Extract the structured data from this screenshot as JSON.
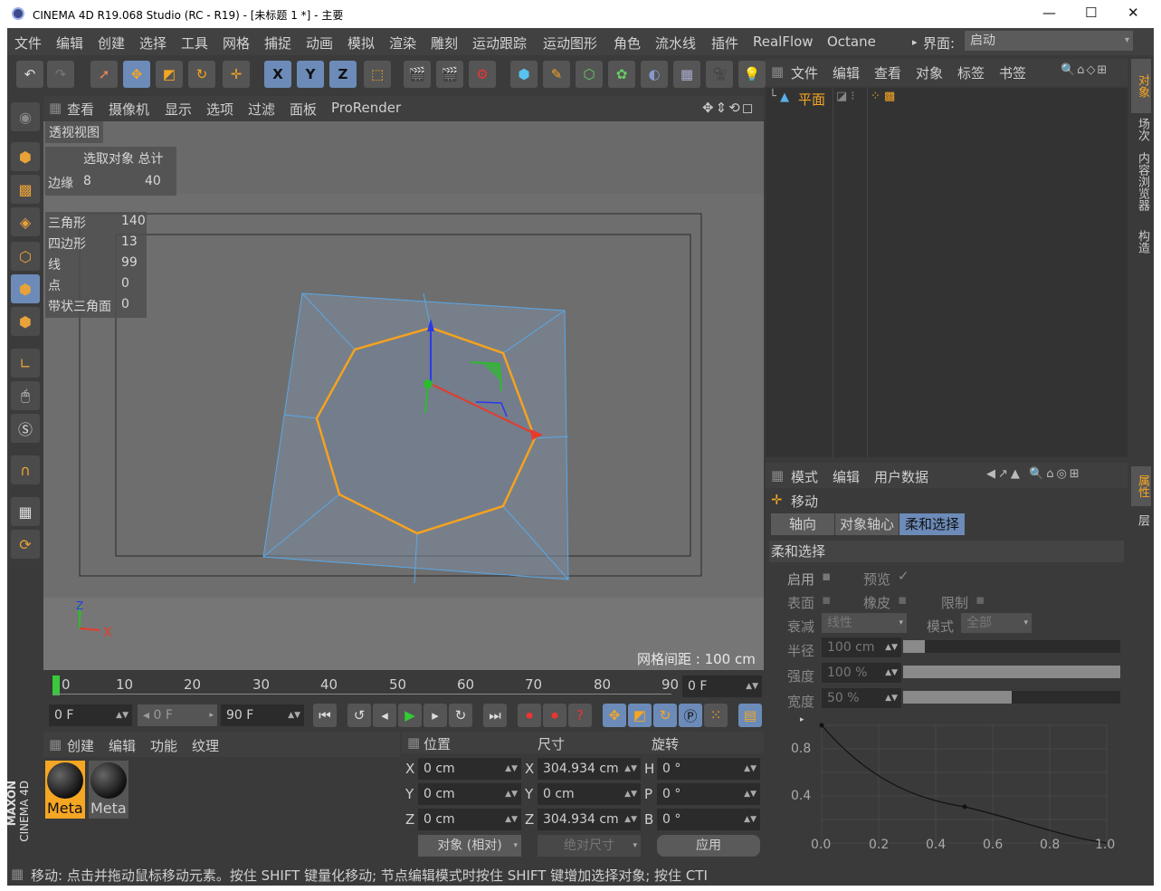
{
  "window": {
    "title": "CINEMA 4D R19.068 Studio (RC - R19) - [未标题 1 *] - 主要",
    "minimize": "—",
    "maximize": "☐",
    "close": "✕"
  },
  "menu": [
    "文件",
    "编辑",
    "创建",
    "选择",
    "工具",
    "网格",
    "捕捉",
    "动画",
    "模拟",
    "渲染",
    "雕刻",
    "运动跟踪",
    "运动图形",
    "角色",
    "流水线",
    "插件",
    "RealFlow",
    "Octane"
  ],
  "layout": {
    "label": "界面:",
    "value": "启动"
  },
  "toolbar": {
    "undo": "↶",
    "redo": "↷",
    "x": "X",
    "y": "Y",
    "z": "Z"
  },
  "viewport": {
    "menu": [
      "查看",
      "摄像机",
      "显示",
      "选项",
      "过滤",
      "面板",
      "ProRender"
    ],
    "name": "透视视图",
    "hud_header": "选取对象 总计",
    "hud_edges_label": "边缘",
    "hud_edges_sel": "8",
    "hud_edges_total": "40",
    "stats": [
      {
        "label": "三角形",
        "value": "140"
      },
      {
        "label": "四边形",
        "value": "13"
      },
      {
        "label": "线",
        "value": "99"
      },
      {
        "label": "点",
        "value": "0"
      },
      {
        "label": "带状三角面",
        "value": "0"
      }
    ],
    "grid": "网格间距 : 100 cm",
    "axis_z": "Z",
    "axis_y": "Y",
    "axis_x": "X"
  },
  "timeline": {
    "ticks": [
      "0",
      "10",
      "20",
      "30",
      "40",
      "50",
      "60",
      "70",
      "80",
      "90"
    ],
    "frame": "0 F",
    "start": "0 F",
    "preview_start": "0 F",
    "end": "90 F"
  },
  "material": {
    "menu": [
      "创建",
      "编辑",
      "功能",
      "纹理"
    ],
    "items": [
      "Meta",
      "Meta"
    ],
    "logo1": "MAXON",
    "logo2": "CINEMA 4D"
  },
  "coords": {
    "hdr_pos": "位置",
    "hdr_size": "尺寸",
    "hdr_rot": "旋转",
    "rows": [
      {
        "a": "X",
        "pos": "0 cm",
        "b": "X",
        "size": "304.934 cm",
        "c": "H",
        "rot": "0 °"
      },
      {
        "a": "Y",
        "pos": "0 cm",
        "b": "Y",
        "size": "0 cm",
        "c": "P",
        "rot": "0 °"
      },
      {
        "a": "Z",
        "pos": "0 cm",
        "b": "Z",
        "size": "304.934 cm",
        "c": "B",
        "rot": "0 °"
      }
    ],
    "mode": "对象 (相对)",
    "size_mode": "绝对尺寸",
    "apply": "应用"
  },
  "objects": {
    "menu": [
      "文件",
      "编辑",
      "查看",
      "对象",
      "标签",
      "书签"
    ],
    "item": "平面",
    "tabs": [
      "对象",
      "场次",
      "内容浏览器",
      "构造"
    ]
  },
  "attributes": {
    "menu": [
      "模式",
      "编辑",
      "用户数据"
    ],
    "tool": "移动",
    "tabs": [
      "轴向",
      "对象轴心",
      "柔和选择"
    ],
    "section": "柔和选择",
    "enable": "启用",
    "preview": "预览",
    "surface": "表面",
    "rubber": "橡皮",
    "limit": "限制",
    "falloff": "衰减",
    "falloff_val": "线性",
    "mode": "模式",
    "mode_val": "全部",
    "radius": "半径",
    "radius_val": "100 cm",
    "strength": "强度",
    "strength_val": "100 %",
    "width": "宽度",
    "width_val": "50 %",
    "strength_level": 1.0,
    "width_level": 0.5,
    "radius_level": 0.1,
    "side_tabs": [
      "属性",
      "层"
    ],
    "curve_y": [
      "0.8",
      "0.4"
    ],
    "curve_x": [
      "0.0",
      "0.2",
      "0.4",
      "0.6",
      "0.8",
      "1.0"
    ]
  },
  "status": "移动: 点击并拖动鼠标移动元素。按住 SHIFT 键量化移动; 节点编辑模式时按住 SHIFT 键增加选择对象; 按住 CTI"
}
